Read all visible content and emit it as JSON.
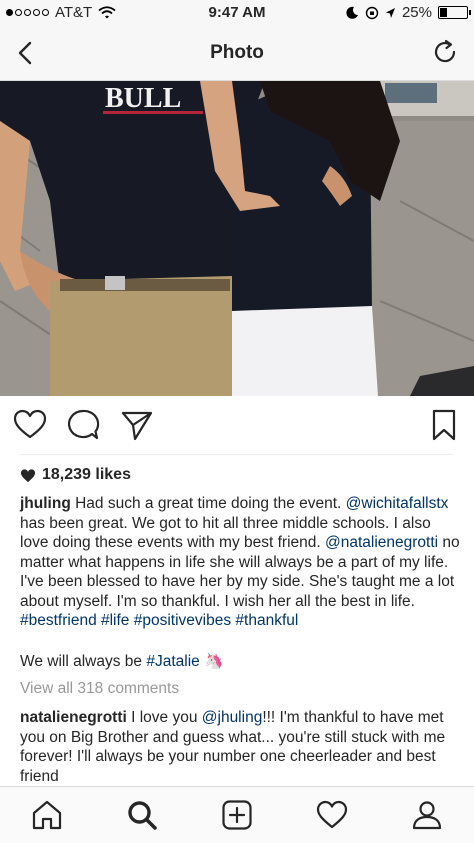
{
  "status_bar": {
    "carrier": "AT&T",
    "time": "9:47 AM",
    "battery": "25%",
    "battery_level": 0.25,
    "signal_bars": 1
  },
  "nav": {
    "title": "Photo"
  },
  "post": {
    "likes": "18,239 likes",
    "caption": {
      "username": "jhuling",
      "text1": " Had such a great time doing the event. ",
      "mention1": "@wichitafallstx",
      "text2": " has been great. We got to hit all three middle schools. I also love doing these events with my best friend. ",
      "mention2": "@natalienegrotti",
      "text3": " no matter what happens in life she will always be a part of my life.  I've been blessed to have her by my side. She's taught me a lot about myself. I'm so thankful. I wish her all the best in life. ",
      "hashtags": "#bestfriend #life #positivevibes #thankful"
    },
    "second_line": {
      "text": "We will always be ",
      "hashtag": "#Jatalie",
      "emoji": "🦄"
    },
    "view_all": "View all 318 comments",
    "comment": {
      "username": "natalienegrotti",
      "text1": " I love you ",
      "mention": "@jhuling",
      "text2": "!!! I'm thankful to have met you on Big Brother and guess what... you're still stuck with me forever! I'll always be your number one cheerleader and best friend"
    }
  },
  "colors": {
    "link": "#003569",
    "muted": "#999999",
    "bar_bg": "#f7f7f7"
  },
  "icons": {
    "back": "chevron-left-icon",
    "refresh": "refresh-icon",
    "like": "heart-icon",
    "comment": "comment-icon",
    "share": "send-icon",
    "save": "bookmark-icon",
    "home": "home-icon",
    "search": "search-icon",
    "add": "add-post-icon",
    "activity": "heart-icon",
    "profile": "profile-icon"
  }
}
